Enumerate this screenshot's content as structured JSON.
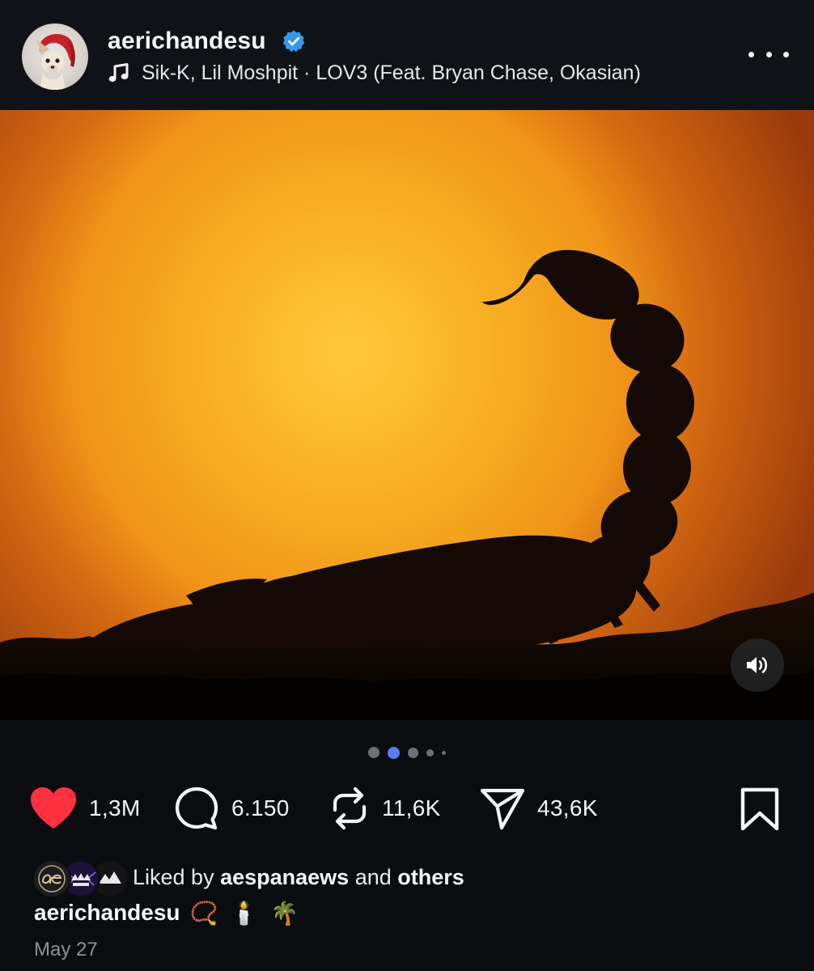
{
  "post": {
    "username": "aerichandesu",
    "verified": true,
    "music": "Sik-K, Lil Moshpit · LOV3 (Feat. Bryan Chase, Okasian)"
  },
  "media": {
    "carousel_total": 5,
    "carousel_active_index": 1,
    "sound_on": true
  },
  "actions": {
    "likes": "1,3M",
    "comments": "6.150",
    "reposts": "11,6K",
    "shares": "43,6K",
    "liked": true
  },
  "liked_by": {
    "prefix": "Liked by",
    "user": "aespanaews",
    "conjunction": "and",
    "suffix": "others"
  },
  "caption": {
    "username": "aerichandesu",
    "emojis": [
      "📿",
      "🕯️",
      "🌴"
    ]
  },
  "date": "May 27",
  "colors": {
    "background": "#0b0c0f",
    "header": "#101218",
    "like": "#ff3040",
    "verified": "#3897f0",
    "active_dot": "#5b7cf0"
  }
}
